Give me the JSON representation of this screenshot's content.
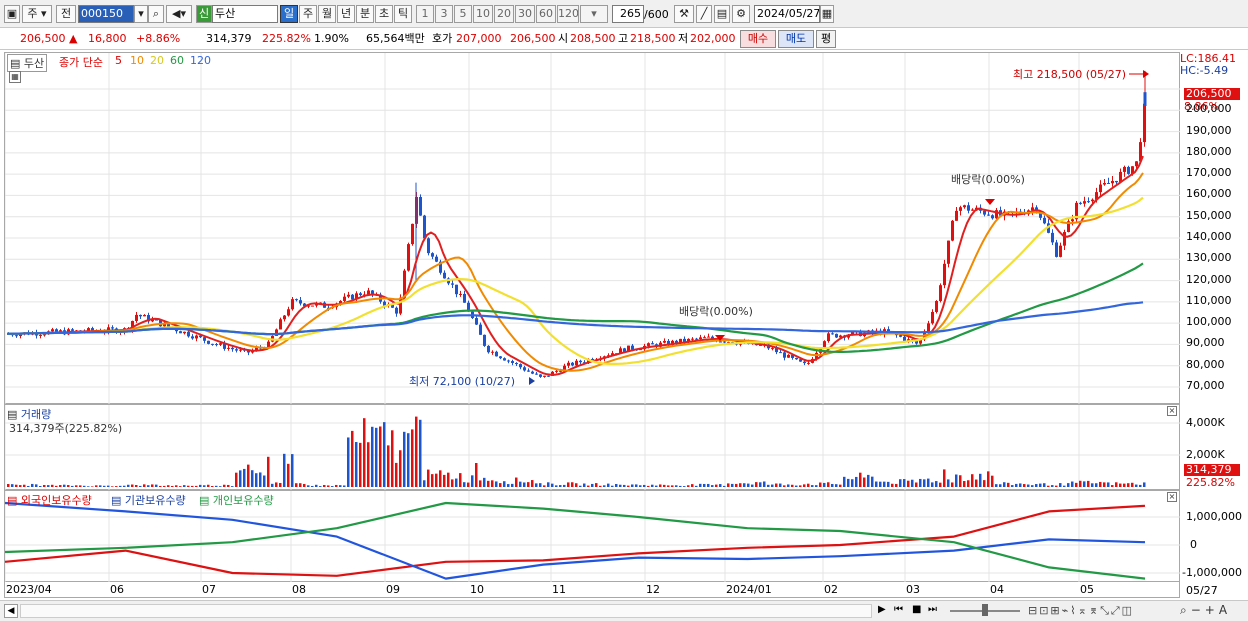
{
  "toolbar": {
    "market": "주",
    "prev_label": "전",
    "code": "000150",
    "name_badge": "신",
    "name": "두산",
    "periods": [
      "일",
      "주",
      "월",
      "년",
      "분",
      "초",
      "틱"
    ],
    "active_period": "일",
    "intervals": [
      "1",
      "3",
      "5",
      "10",
      "20",
      "30",
      "60",
      "120"
    ],
    "count": "265",
    "count_total": "/600",
    "date": "2024/05/27"
  },
  "quote": {
    "price": "206,500",
    "change": "16,800",
    "change_pct": "+8.86%",
    "volume": "314,379",
    "volume_ratio": "225.82%",
    "turnover_pct": "1.90%",
    "amount": "65,564백만",
    "bid_label": "호가",
    "bid": "207,000",
    "ask": "206,500",
    "open_label": "시",
    "open": "208,500",
    "high_label": "고",
    "high": "218,500",
    "low_label": "저",
    "low": "202,000",
    "buy_label": "매수",
    "sell_label": "매도",
    "eval_label": "평"
  },
  "price_panel": {
    "stock_name": "두산",
    "legend_prefix": "종가 단순",
    "ma_labels": [
      "5",
      "10",
      "20",
      "60",
      "120"
    ],
    "ma_colors": [
      "#e02020",
      "#f08a00",
      "#f2e030",
      "#229944",
      "#3366dd"
    ],
    "lc_label": "LC:186.41",
    "hc_label": "HC:-5.49",
    "price_tag": "206,500",
    "pct_tag": "8.86%",
    "high_annotation": "최고 218,500 (05/27)",
    "low_annotation": "최저 72,100 (10/27)",
    "dividend_labels": [
      "배당락(0.00%)",
      "배당락(0.00%)"
    ],
    "yticks": [
      "210,000",
      "200,000",
      "190,000",
      "180,000",
      "170,000",
      "160,000",
      "150,000",
      "140,000",
      "130,000",
      "120,000",
      "110,000",
      "100,000",
      "90,000",
      "80,000",
      "70,000"
    ]
  },
  "volume_panel": {
    "title": "거래량",
    "summary": "314,379주(225.82%)",
    "yticks": [
      "4,000K",
      "2,000K"
    ],
    "tag": "314,379",
    "tag_pct": "225.82%"
  },
  "holdings_panel": {
    "series": [
      "외국인보유수량",
      "기관보유수량",
      "개인보유수량"
    ],
    "series_colors": [
      "#dd1111",
      "#2255dd",
      "#229944"
    ],
    "yticks": [
      "1,000,000",
      "0",
      "-1,000,000"
    ]
  },
  "xaxis": {
    "labels": [
      "2023/04",
      "06",
      "07",
      "08",
      "09",
      "10",
      "11",
      "12",
      "2024/01",
      "02",
      "03",
      "04",
      "05"
    ],
    "last_date": "05/27"
  },
  "chart_data": {
    "type": "candlestick",
    "yrange": [
      66000,
      221000
    ],
    "price_path_points": [
      [
        2023.27,
        95000
      ],
      [
        2023.42,
        97000
      ],
      [
        2023.47,
        104000
      ],
      [
        2023.55,
        90000
      ],
      [
        2023.6,
        86000
      ],
      [
        2023.64,
        90000
      ],
      [
        2023.66,
        110000
      ],
      [
        2023.72,
        108000
      ],
      [
        2023.76,
        115000
      ],
      [
        2023.8,
        105000
      ],
      [
        2023.81,
        160000
      ],
      [
        2023.83,
        135000
      ],
      [
        2023.87,
        108000
      ],
      [
        2023.92,
        88000
      ],
      [
        2023.99,
        74000
      ],
      [
        2024.03,
        80000
      ],
      [
        2024.1,
        88000
      ],
      [
        2024.18,
        93000
      ],
      [
        2024.24,
        89000
      ],
      [
        2024.27,
        82000
      ],
      [
        2024.3,
        80000
      ],
      [
        2024.34,
        94000
      ],
      [
        2024.4,
        96000
      ],
      [
        2024.46,
        90000
      ],
      [
        2024.49,
        110000
      ],
      [
        2024.53,
        155000
      ],
      [
        2024.6,
        150000
      ],
      [
        2024.64,
        155000
      ],
      [
        2024.67,
        133000
      ],
      [
        2024.72,
        155000
      ],
      [
        2024.78,
        165000
      ],
      [
        2024.82,
        175000
      ],
      [
        2024.84,
        206500
      ]
    ],
    "volume_K": [
      200,
      150,
      120,
      180,
      140,
      160,
      2100,
      300,
      150,
      4400,
      4200,
      1100,
      800,
      600,
      300,
      250,
      200,
      180,
      200,
      400,
      250,
      300,
      900,
      500,
      700,
      1100,
      300,
      250,
      400,
      314
    ],
    "holdings": {
      "foreign": [
        -600000,
        -200000,
        -1000000,
        -1100000,
        -600000,
        -550000,
        -300000,
        -100000,
        0,
        300000,
        1200000,
        1400000
      ],
      "institution": [
        1500000,
        1200000,
        900000,
        300000,
        -1200000,
        -700000,
        -450000,
        -500000,
        -400000,
        -200000,
        200000,
        100000
      ],
      "individual": [
        -250000,
        -100000,
        100000,
        600000,
        1500000,
        1300000,
        1000000,
        600000,
        500000,
        100000,
        -800000,
        -1200000
      ]
    }
  }
}
